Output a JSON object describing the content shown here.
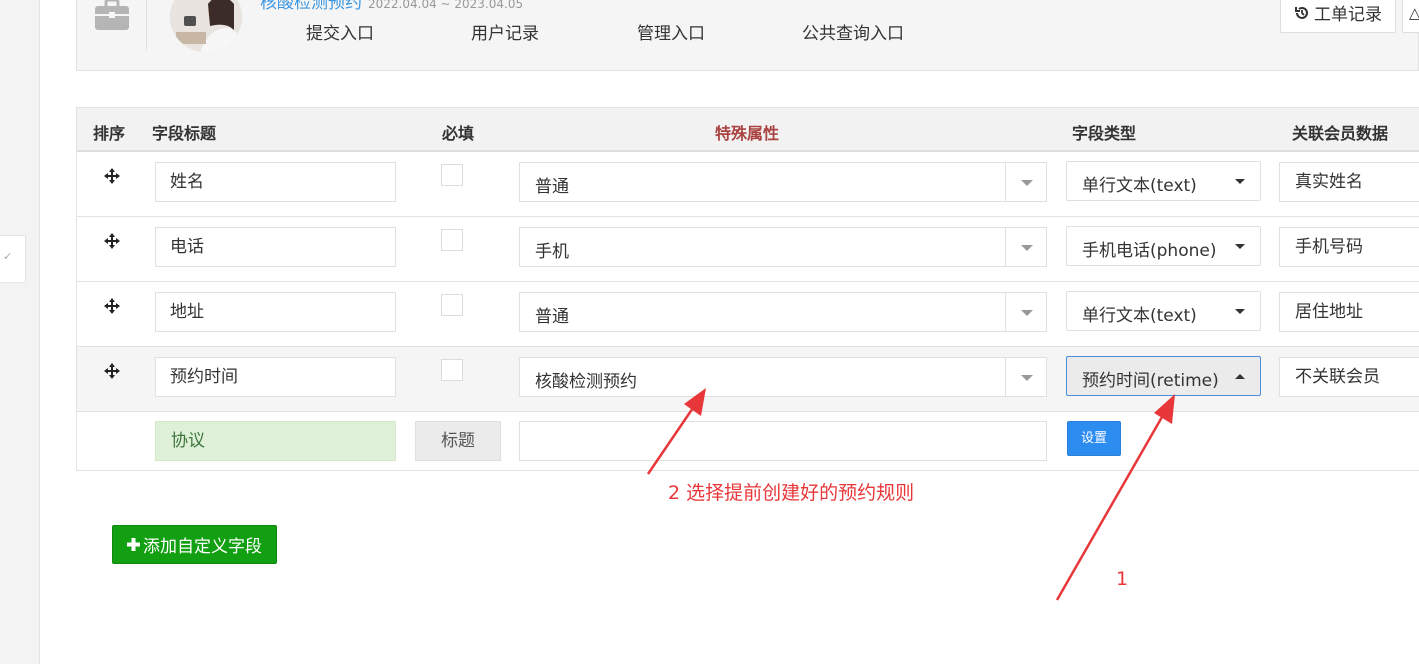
{
  "header": {
    "app_title": "核酸检测预约",
    "date_range": "2022.04.04 ~ 2023.04.05",
    "nav_links": [
      "提交入口",
      "用户记录",
      "管理入口",
      "公共查询入口"
    ],
    "work_order_button": "工单记录"
  },
  "table": {
    "columns": [
      "排序",
      "字段标题",
      "必填",
      "特殊属性",
      "字段类型",
      "关联会员数据"
    ],
    "rows": [
      {
        "field_title": "姓名",
        "required": false,
        "special_attr": "普通",
        "field_type": "单行文本(text)",
        "member_data": "真实姓名"
      },
      {
        "field_title": "电话",
        "required": false,
        "special_attr": "手机",
        "field_type": "手机电话(phone)",
        "member_data": "手机号码"
      },
      {
        "field_title": "地址",
        "required": false,
        "special_attr": "普通",
        "field_type": "单行文本(text)",
        "member_data": "居住地址"
      },
      {
        "field_title": "预约时间",
        "required": false,
        "special_attr": "核酸检测预约",
        "field_type": "预约时间(retime)",
        "member_data": "不关联会员"
      }
    ],
    "agreement_row": {
      "label": "协议",
      "title_button": "标题",
      "input_value": "",
      "settings_button": "设置"
    }
  },
  "add_field_button": "添加自定义字段",
  "annotations": {
    "step1": "1",
    "step2": "2 选择提前创建好的预约规则"
  },
  "colors": {
    "link_blue": "#3a95e0",
    "header_red": "#a94442",
    "settings_blue": "#2d8cf0",
    "add_green": "#12a012",
    "agreement_green_bg": "#dff0d8",
    "annotation_red": "#e8373a"
  },
  "icons": {
    "briefcase": "briefcase-icon",
    "drag": "move-arrows-icon",
    "history": "history-icon",
    "plus": "plus-icon"
  }
}
